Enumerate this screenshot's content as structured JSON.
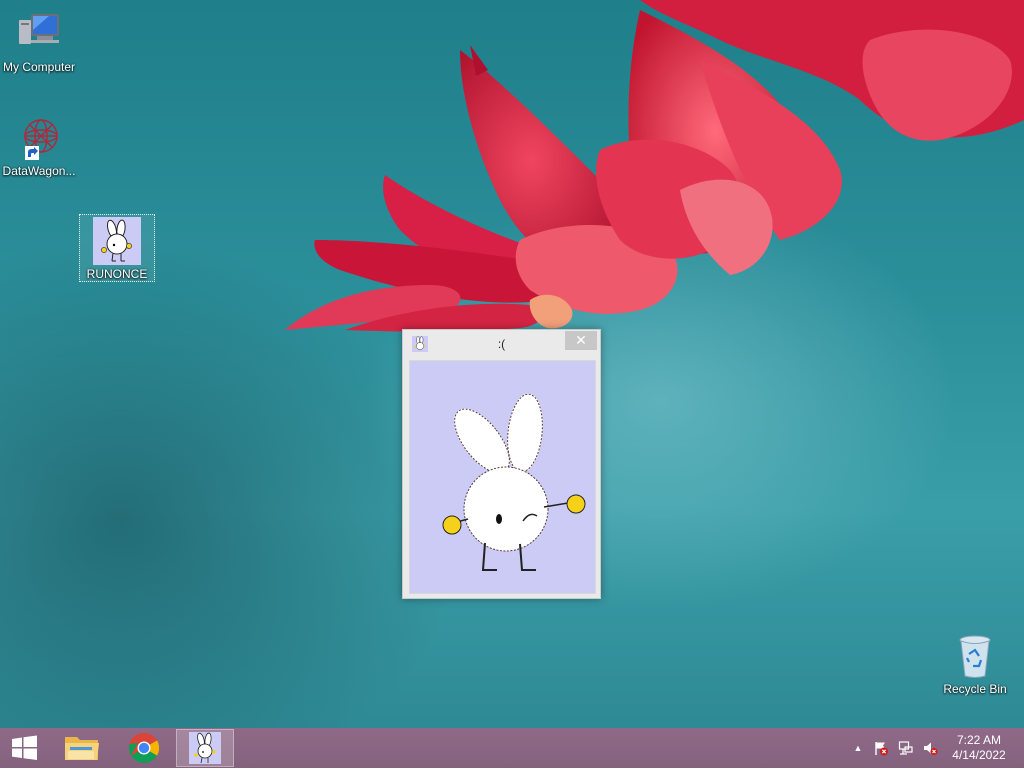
{
  "desktop": {
    "icons": [
      {
        "label": "My Computer"
      },
      {
        "label": "DataWagon..."
      },
      {
        "label": "RUNONCE"
      },
      {
        "label": "Recycle Bin"
      }
    ]
  },
  "window": {
    "title": ":(",
    "close_glyph": "✕"
  },
  "taskbar": {
    "clock_time": "7:22 AM",
    "clock_date": "4/14/2022",
    "tray_chevron": "▲"
  },
  "icons": {
    "start": "windows-logo-icon",
    "explorer": "folder-icon",
    "chrome": "chrome-icon",
    "runonce": "bunny-icon",
    "my_computer": "computer-icon",
    "datawagon": "network-globe-icon",
    "recycle_bin": "recycle-bin-icon",
    "action_center": "flag-icon",
    "network": "network-icon",
    "volume": "speaker-muted-icon"
  },
  "colors": {
    "taskbar": "#8a6684",
    "window_client": "#cccbf6",
    "desktop": "#2b8f9a",
    "flower": "#e0284a"
  }
}
